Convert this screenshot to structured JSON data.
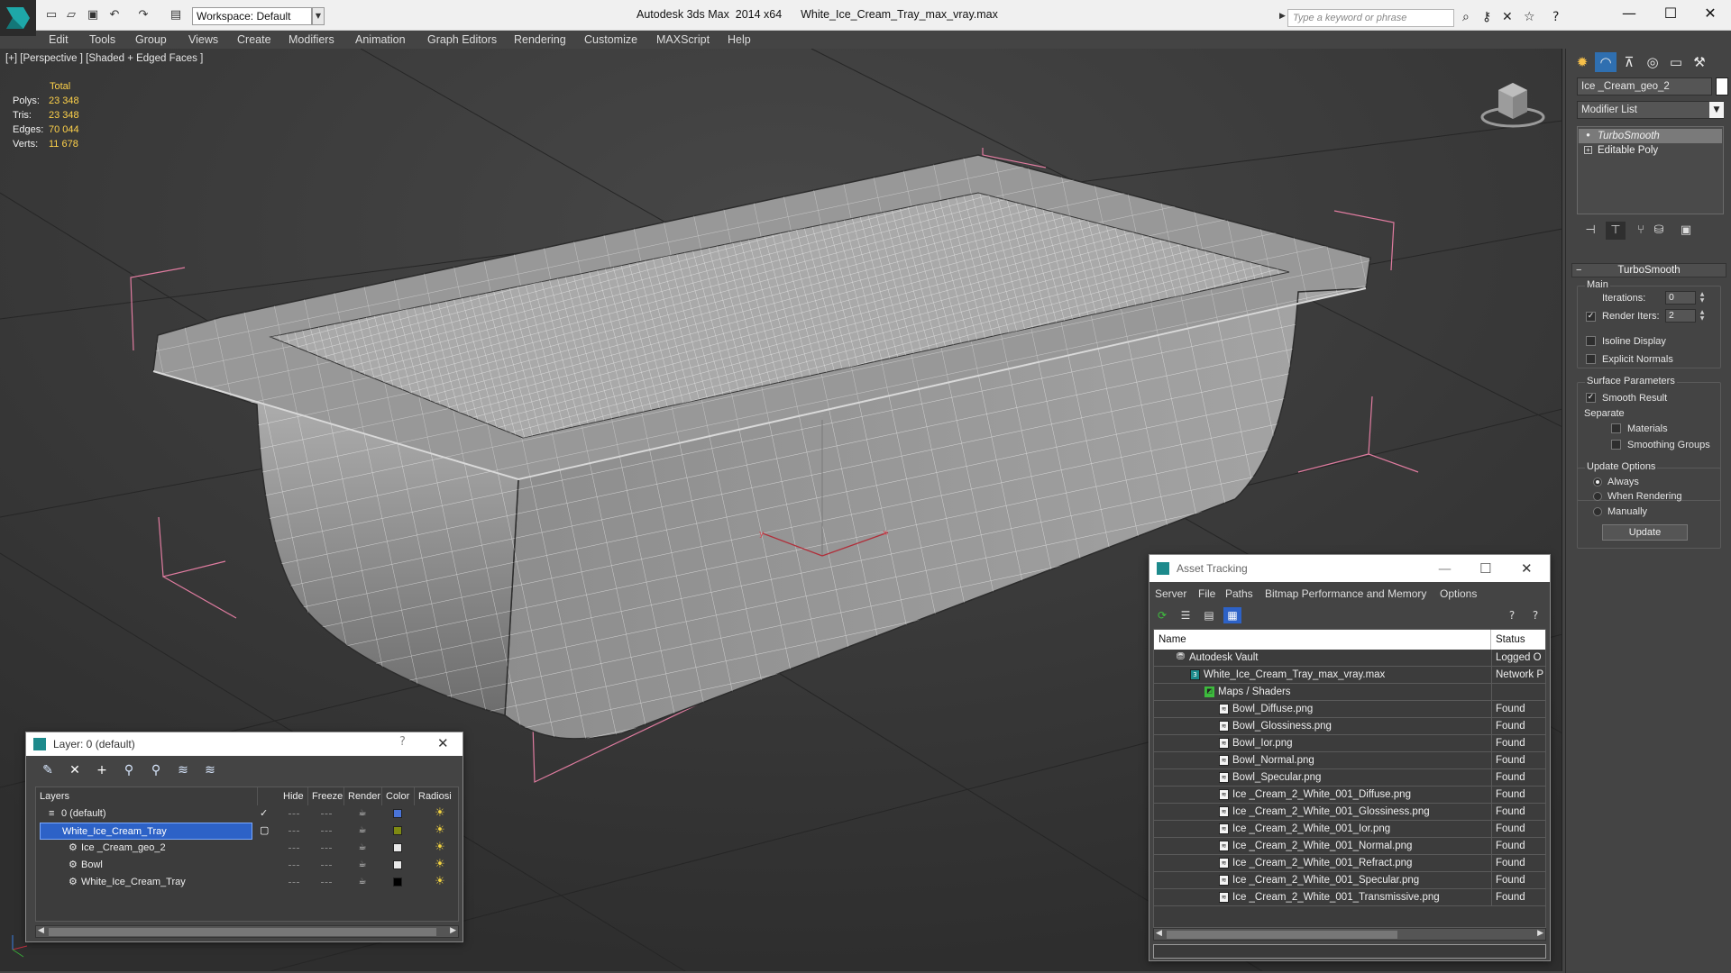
{
  "titlebar": {
    "app": "Autodesk 3ds Max  2014 x64",
    "file": "White_Ice_Cream_Tray_max_vray.max",
    "workspace": "Workspace: Default",
    "search_placeholder": "Type a keyword or phrase",
    "quick_access_icons": [
      "new-icon",
      "open-icon",
      "save-icon",
      "undo-icon",
      "redo-icon",
      "project-icon"
    ],
    "help_icons": [
      "binoculars-icon",
      "key-icon",
      "tools-icon",
      "star-icon",
      "help-icon"
    ]
  },
  "menu": [
    "Edit",
    "Tools",
    "Group",
    "Views",
    "Create",
    "Modifiers",
    "Animation",
    "Graph Editors",
    "Rendering",
    "Customize",
    "MAXScript",
    "Help"
  ],
  "viewport": {
    "label": "[+] [Perspective ] [Shaded + Edged Faces ]",
    "stats": {
      "total_label": "Total",
      "rows": [
        {
          "label": "Polys:",
          "value": "23 348"
        },
        {
          "label": "Tris:",
          "value": "23 348"
        },
        {
          "label": "Edges:",
          "value": "70 044"
        },
        {
          "label": "Verts:",
          "value": "11 678"
        }
      ]
    },
    "gizmo": {
      "x": "x",
      "y": "y",
      "z": "z"
    }
  },
  "command_panel": {
    "tabs": [
      "create-icon",
      "modify-icon",
      "hierarchy-icon",
      "motion-icon",
      "display-icon",
      "utilities-icon"
    ],
    "object_name": "Ice _Cream_geo_2",
    "object_color": "#ffffff",
    "modifier_list": "Modifier List",
    "stack": [
      {
        "label": "TurboSmooth",
        "selected": true
      },
      {
        "label": "Editable Poly",
        "selected": false
      }
    ],
    "rollout": "TurboSmooth",
    "main": {
      "title": "Main",
      "iterations_label": "Iterations:",
      "iterations": "0",
      "render_iters_label": "Render Iters:",
      "render_iters": "2",
      "render_iters_checked": true,
      "isoline_label": "Isoline Display",
      "explicit_label": "Explicit Normals"
    },
    "surface": {
      "title": "Surface Parameters",
      "smooth_label": "Smooth Result",
      "separate_label": "Separate",
      "materials_label": "Materials",
      "smoothing_label": "Smoothing Groups"
    },
    "update": {
      "title": "Update Options",
      "options": [
        "Always",
        "When Rendering",
        "Manually"
      ],
      "selected": "Always",
      "button": "Update"
    }
  },
  "layer_dialog": {
    "title": "Layer: 0 (default)",
    "help": "?",
    "columns": [
      "Layers",
      "Hide",
      "Freeze",
      "Render",
      "Color",
      "Radiosi"
    ],
    "rows": [
      {
        "name": "0 (default)",
        "indent": 0,
        "color": "#4a74d8",
        "active": true
      },
      {
        "name": "White_Ice_Cream_Tray",
        "indent": 0,
        "color": "#7f8a12",
        "selected": true
      },
      {
        "name": "Ice _Cream_geo_2",
        "indent": 1,
        "color": "#e8e8e8"
      },
      {
        "name": "Bowl",
        "indent": 1,
        "color": "#e8e8e8"
      },
      {
        "name": "White_Ice_Cream_Tray",
        "indent": 1,
        "color": "#000000"
      }
    ]
  },
  "asset_dialog": {
    "title": "Asset Tracking",
    "menu": [
      "Server",
      "File",
      "Paths",
      "Bitmap Performance and Memory",
      "Options"
    ],
    "columns": [
      "Name",
      "Status"
    ],
    "rows": [
      {
        "name": "Autodesk Vault",
        "status": "Logged O",
        "indent": 0,
        "icon": "vault-icon"
      },
      {
        "name": "White_Ice_Cream_Tray_max_vray.max",
        "status": "Network P",
        "indent": 1,
        "icon": "max-file-icon"
      },
      {
        "name": "Maps / Shaders",
        "status": "",
        "indent": 2,
        "icon": "maps-folder-icon"
      },
      {
        "name": "Bowl_Diffuse.png",
        "status": "Found",
        "indent": 3,
        "icon": "bitmap-icon"
      },
      {
        "name": "Bowl_Glossiness.png",
        "status": "Found",
        "indent": 3,
        "icon": "bitmap-icon"
      },
      {
        "name": "Bowl_Ior.png",
        "status": "Found",
        "indent": 3,
        "icon": "bitmap-icon"
      },
      {
        "name": "Bowl_Normal.png",
        "status": "Found",
        "indent": 3,
        "icon": "bitmap-icon"
      },
      {
        "name": "Bowl_Specular.png",
        "status": "Found",
        "indent": 3,
        "icon": "bitmap-icon"
      },
      {
        "name": "Ice _Cream_2_White_001_Diffuse.png",
        "status": "Found",
        "indent": 3,
        "icon": "bitmap-icon"
      },
      {
        "name": "Ice _Cream_2_White_001_Glossiness.png",
        "status": "Found",
        "indent": 3,
        "icon": "bitmap-icon"
      },
      {
        "name": "Ice _Cream_2_White_001_Ior.png",
        "status": "Found",
        "indent": 3,
        "icon": "bitmap-icon"
      },
      {
        "name": "Ice _Cream_2_White_001_Normal.png",
        "status": "Found",
        "indent": 3,
        "icon": "bitmap-icon"
      },
      {
        "name": "Ice _Cream_2_White_001_Refract.png",
        "status": "Found",
        "indent": 3,
        "icon": "bitmap-icon"
      },
      {
        "name": "Ice _Cream_2_White_001_Specular.png",
        "status": "Found",
        "indent": 3,
        "icon": "bitmap-icon"
      },
      {
        "name": "Ice _Cream_2_White_001_Transmissive.png",
        "status": "Found",
        "indent": 3,
        "icon": "bitmap-icon"
      }
    ]
  }
}
